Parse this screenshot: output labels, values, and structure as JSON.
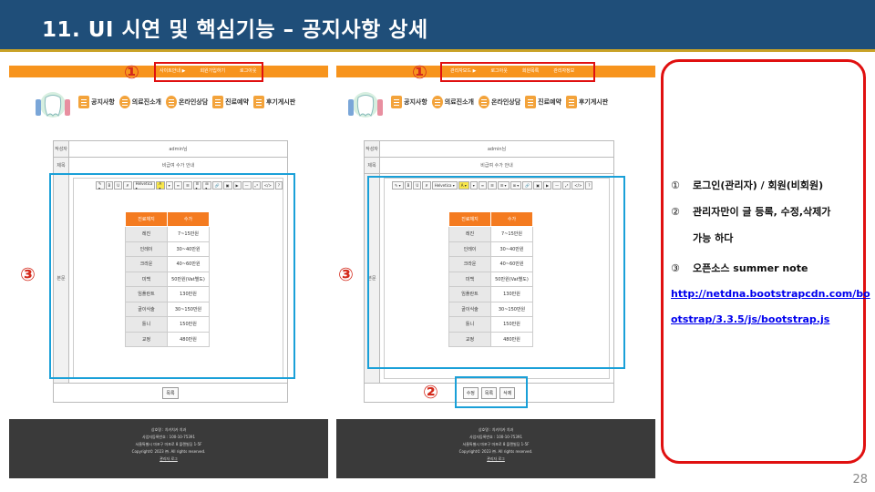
{
  "title": "11. UI 시연 및 핵심기능 – 공지사항 상세",
  "page_number": "28",
  "left_shot": {
    "nav": [
      "사이트안내 ▶",
      "회원가입하기",
      "로그아웃"
    ],
    "menu": [
      "공지사항",
      "의료진소개",
      "온라인상담",
      "진료예약",
      "후기게시판"
    ],
    "writer_label": "작성자",
    "writer_value": "admin님",
    "subject_label": "제목",
    "subject_value": "비급여 수가 안내",
    "body_label": "본문",
    "buttons": [
      "목록"
    ]
  },
  "right_shot": {
    "nav": [
      "관리자모드 ▶",
      "로그아웃",
      "회원목록",
      "관리자정보"
    ],
    "menu": [
      "공지사항",
      "의료진소개",
      "온라인상담",
      "진료예약",
      "후기게시판"
    ],
    "writer_label": "작성자",
    "writer_value": "admin님",
    "subject_label": "제목",
    "subject_value": "비급여 수가 안내",
    "body_label": "본문",
    "buttons": [
      "수정",
      "목록",
      "삭제"
    ]
  },
  "toolbar": [
    "✎ ▾",
    "B",
    "U",
    "✗",
    "Helvetica ▾",
    "A ▾",
    "▾",
    "≡",
    "☰",
    "☰ ▾",
    "⊞ ▾",
    "🔗",
    "▣",
    "▶",
    "—",
    "⤢",
    "</>",
    "?"
  ],
  "price_table": {
    "headers": [
      "진료체지",
      "수가"
    ],
    "rows": [
      [
        "레진",
        "7~15만원"
      ],
      [
        "인레이",
        "30~40만원"
      ],
      [
        "크라운",
        "40~60만원"
      ],
      [
        "미백",
        "50만원(Vat별도)"
      ],
      [
        "임플란트",
        "130만원"
      ],
      [
        "골이식술",
        "30~150만원"
      ],
      [
        "틀니",
        "150만원"
      ],
      [
        "교정",
        "480만원"
      ]
    ]
  },
  "footer": {
    "l0": "상호명 : 치카치카 치과",
    "l1": "사업자등록번호 : 100-10-75391",
    "l2": "서울특별시 마포구 마포로 8 플랜빌딩 1-5F",
    "l3": "Copyright© 2023 ㈜. All rights reserved.",
    "l4": "관리자 로그"
  },
  "markers": {
    "one": "①",
    "two": "②",
    "three": "③"
  },
  "notes": {
    "n1_marker": "①",
    "n1": "로그인(관리자) / 회원(비회원)",
    "n2_marker": "②",
    "n2a": "관리자만이 글 등록, 수정,삭제가",
    "n2b": "가능 하다",
    "n3_marker": "③",
    "n3": "오픈소스 summer note",
    "link_a": "http://netdna.bootstrapcdn.com/bo",
    "link_b": "otstrap/3.3.5/js/bootstrap.js"
  },
  "colors": {
    "title_bg": "#1f4e79",
    "nav_orange": "#f7941d",
    "annot_red": "#e01010",
    "annot_blue": "#1aa0d8"
  }
}
